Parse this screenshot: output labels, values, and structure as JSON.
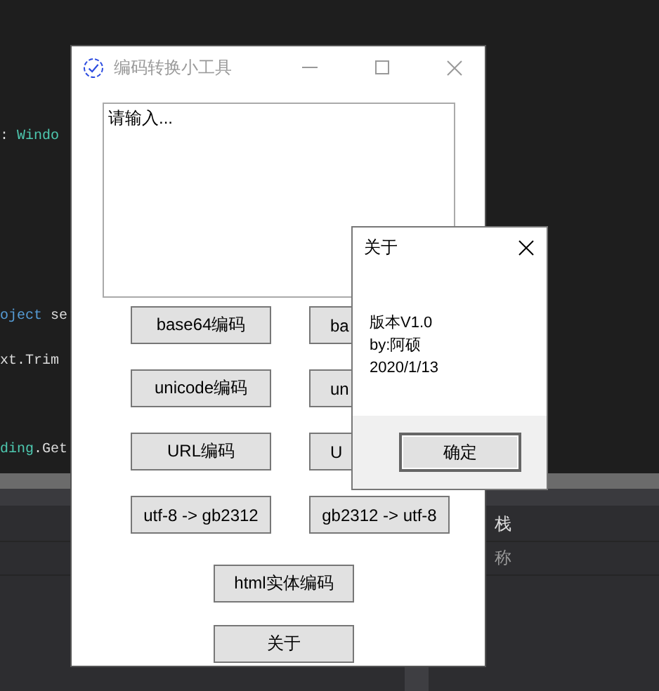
{
  "editor_code": [
    {
      "parts": [
        {
          "kind": "plain",
          "text": ": "
        },
        {
          "kind": "type",
          "text": "Windo"
        }
      ]
    },
    {
      "parts": [
        {
          "kind": "keyword",
          "text": "oject"
        },
        {
          "kind": "plain",
          "text": " se"
        }
      ]
    },
    {
      "parts": [
        {
          "kind": "plain",
          "text": "xt.Trim"
        }
      ]
    },
    {
      "parts": [
        {
          "kind": "type",
          "text": "ding"
        },
        {
          "kind": "plain",
          "text": ".Get"
        }
      ]
    }
  ],
  "side_panel": {
    "items": [
      "栈",
      "称"
    ]
  },
  "main_window": {
    "title": "编码转换小工具",
    "input": {
      "placeholder": "请输入..."
    },
    "button_rows": [
      {
        "left": "base64编码",
        "right": "ba"
      },
      {
        "left": "unicode编码",
        "right": "un"
      },
      {
        "left": "URL编码",
        "right": "U"
      },
      {
        "left": "utf-8 -> gb2312",
        "right": "gb2312 -> utf-8"
      }
    ],
    "bottom_buttons": [
      "html实体编码",
      "关于"
    ]
  },
  "about_dialog": {
    "title": "关于",
    "lines": [
      "版本V1.0",
      "by:阿硕",
      "2020/1/13"
    ],
    "ok_button": "确定"
  }
}
